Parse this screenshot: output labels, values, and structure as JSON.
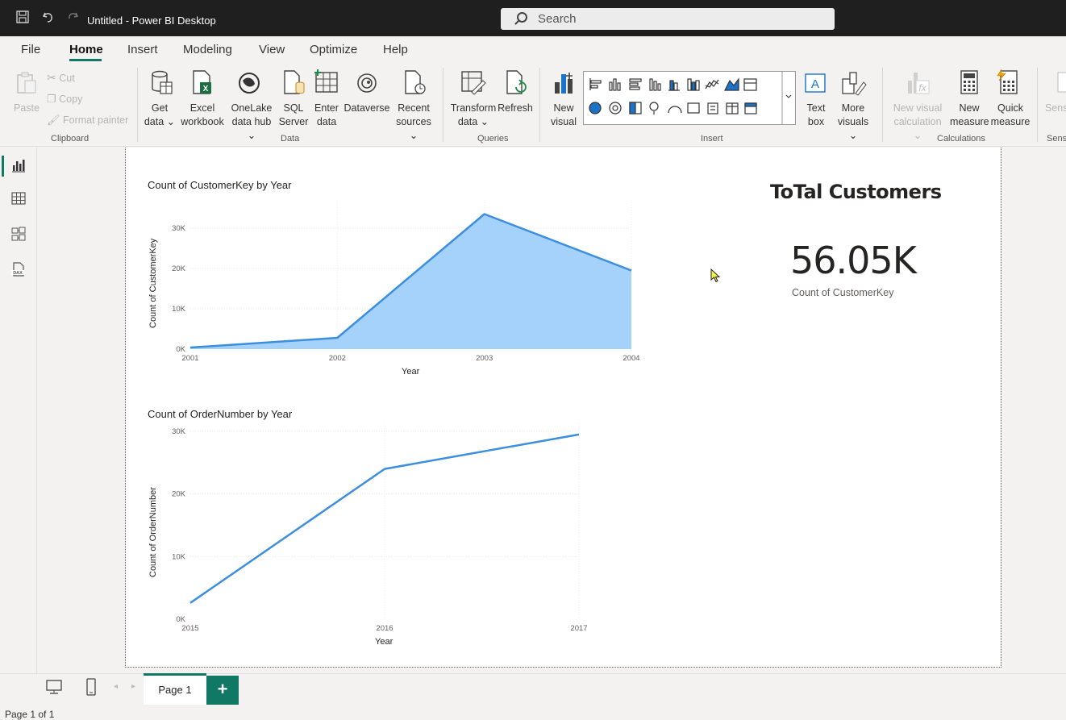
{
  "titlebar": {
    "title": "Untitled - Power BI Desktop",
    "search_placeholder": "Search",
    "icons": [
      "save-icon",
      "undo-icon",
      "redo-icon",
      "search-icon"
    ]
  },
  "menu": {
    "items": [
      "File",
      "Home",
      "Insert",
      "Modeling",
      "View",
      "Optimize",
      "Help"
    ],
    "active": "Home"
  },
  "ribbon": {
    "clipboard": {
      "paste": "Paste",
      "cut": "Cut",
      "copy": "Copy",
      "format_painter": "Format painter",
      "label": "Clipboard"
    },
    "data": {
      "get_data_1": "Get",
      "get_data_2": "data",
      "excel_1": "Excel",
      "excel_2": "workbook",
      "onelake_1": "OneLake",
      "onelake_2": "data hub",
      "sql_1": "SQL",
      "sql_2": "Server",
      "enter_1": "Enter",
      "enter_2": "data",
      "dataverse": "Dataverse",
      "recent_1": "Recent",
      "recent_2": "sources",
      "label": "Data"
    },
    "queries": {
      "transform_1": "Transform",
      "transform_2": "data",
      "refresh": "Refresh",
      "label": "Queries"
    },
    "insert": {
      "new_visual_1": "New",
      "new_visual_2": "visual",
      "text_box_1": "Text",
      "text_box_2": "box",
      "more_visuals_1": "More",
      "more_visuals_2": "visuals",
      "label": "Insert"
    },
    "calculations": {
      "new_visual_calc_1": "New visual",
      "new_visual_calc_2": "calculation",
      "new_measure_1": "New",
      "new_measure_2": "measure",
      "quick_measure_1": "Quick",
      "quick_measure_2": "measure",
      "label": "Calculations"
    },
    "sensitivity": {
      "button": "Sens",
      "label": "Sens"
    }
  },
  "report": {
    "card": {
      "title": "ToTal Customers",
      "value": "56.05K",
      "label": "Count of CustomerKey"
    }
  },
  "chart_data": [
    {
      "type": "area",
      "title": "Count of CustomerKey by Year",
      "xlabel": "Year",
      "ylabel": "Count of CustomerKey",
      "x": [
        "2001",
        "2002",
        "2003",
        "2004"
      ],
      "values": [
        400,
        2800,
        33500,
        19500
      ],
      "yticks": [
        "0K",
        "10K",
        "20K",
        "30K"
      ],
      "ylim": [
        0,
        35000
      ],
      "color": "#3c8ee0",
      "fill": "#a5d2fa"
    },
    {
      "type": "line",
      "title": "Count of OrderNumber by Year",
      "xlabel": "Year",
      "ylabel": "Count of OrderNumber",
      "x": [
        "2015",
        "2016",
        "2017"
      ],
      "values": [
        2600,
        24000,
        29500
      ],
      "yticks": [
        "0K",
        "10K",
        "20K",
        "30K"
      ],
      "ylim": [
        0,
        30000
      ],
      "color": "#3c8ee0"
    }
  ],
  "footer": {
    "page_tab": "Page 1",
    "add_page": "+",
    "page_count": "Page 1 of 1"
  }
}
